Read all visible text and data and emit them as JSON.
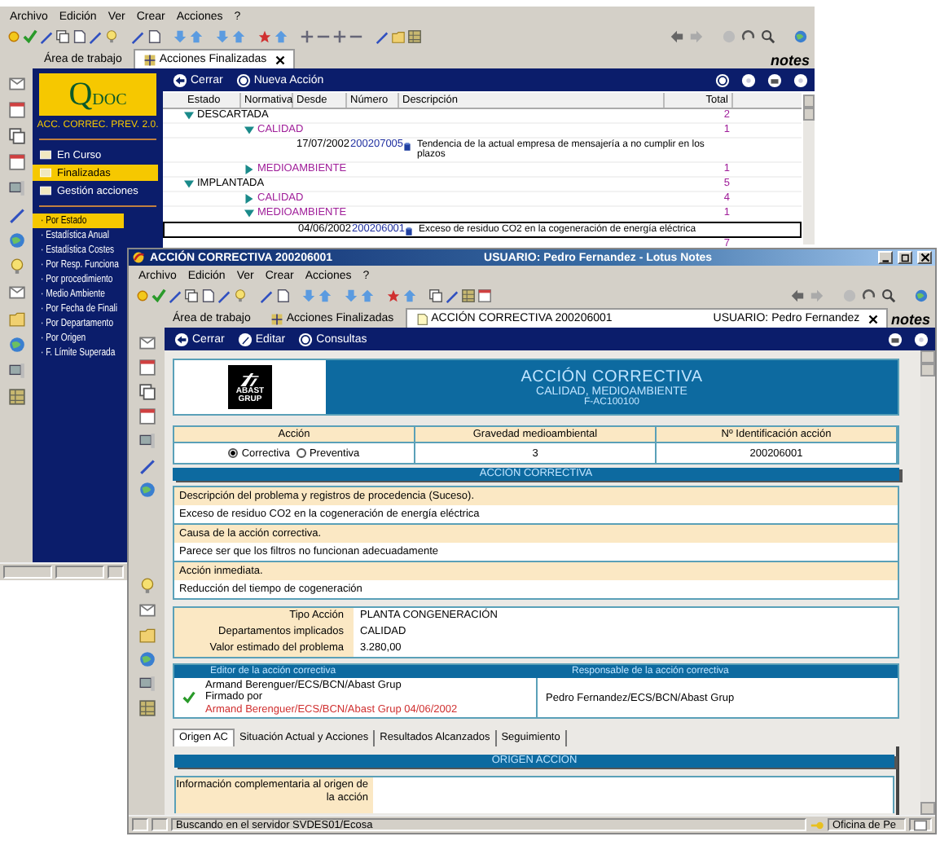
{
  "back_window": {
    "menu": [
      "Archivo",
      "Edición",
      "Ver",
      "Crear",
      "Acciones",
      "?"
    ],
    "tabs": [
      {
        "label": "Área de trabajo",
        "selected": false,
        "closable": false
      },
      {
        "label": "Acciones Finalizadas",
        "selected": true,
        "closable": true
      }
    ],
    "brand": "notes",
    "nav": {
      "logo_initial": "Q",
      "logo_rest": "DOC",
      "subtitle": "ACC. CORREC. PREV. 2.0.",
      "items": [
        {
          "label": "En Curso",
          "selected": false
        },
        {
          "label": "Finalizadas",
          "selected": true
        },
        {
          "label": "Gestión acciones",
          "selected": false
        }
      ],
      "views": [
        {
          "label": "· Por Estado",
          "selected": true
        },
        {
          "label": "· Estadística Anual",
          "selected": false
        },
        {
          "label": "· Estadística Costes",
          "selected": false
        },
        {
          "label": "· Por Resp. Funciona",
          "selected": false
        },
        {
          "label": "· Por procedimiento",
          "selected": false
        },
        {
          "label": "· Medio Ambiente",
          "selected": false
        },
        {
          "label": "· Por Fecha de Finali",
          "selected": false
        },
        {
          "label": "· Por Departamento",
          "selected": false
        },
        {
          "label": "· Por Origen",
          "selected": false
        },
        {
          "label": "· F. Límite Superada",
          "selected": false
        }
      ]
    },
    "actions": [
      "Cerrar",
      "Nueva Acción"
    ],
    "table": {
      "columns": [
        "Estado",
        "Normativa",
        "Desde",
        "Número",
        "Descripción",
        "Total"
      ],
      "rows": [
        {
          "label": "DESCARTADA",
          "expanded": true,
          "total": "2",
          "children": [
            {
              "label": "CALIDAD",
              "expanded": true,
              "total": "1",
              "children": [
                {
                  "date": "17/07/2002",
                  "number": "200207005",
                  "description": "Tendencia de la actual empresa de mensajería a no cumplir en los plazos",
                  "selected": false
                }
              ]
            },
            {
              "label": "MEDIOAMBIENTE",
              "expanded": false,
              "total": "1"
            }
          ]
        },
        {
          "label": "IMPLANTADA",
          "expanded": true,
          "total": "5",
          "children": [
            {
              "label": "CALIDAD",
              "expanded": false,
              "total": "4"
            },
            {
              "label": "MEDIOAMBIENTE",
              "expanded": true,
              "total": "1",
              "children": [
                {
                  "date": "04/06/2002",
                  "number": "200206001",
                  "description": "Exceso de residuo CO2 en la cogeneración de energía eléctrica",
                  "selected": true
                }
              ]
            }
          ]
        }
      ],
      "grand_total": "7"
    }
  },
  "front_window": {
    "title": "ACCIÓN CORRECTIVA 200206001",
    "title_user": "USUARIO: Pedro Fernandez - Lotus Notes",
    "menu": [
      "Archivo",
      "Edición",
      "Ver",
      "Crear",
      "Acciones",
      "?"
    ],
    "tabs": [
      {
        "label": "Área de trabajo",
        "selected": false,
        "closable": false
      },
      {
        "label": "Acciones Finalizadas",
        "selected": false,
        "closable": false
      },
      {
        "label": "ACCIÓN CORRECTIVA 200206001",
        "user": "USUARIO: Pedro Fernandez",
        "selected": true,
        "closable": true
      }
    ],
    "brand": "notes",
    "actions": [
      "Cerrar",
      "Editar",
      "Consultas"
    ],
    "form": {
      "header": {
        "logo_top": "ABAST",
        "logo_bottom": "GRUP",
        "title": "ACCIÓN CORRECTIVA",
        "subtitle": "CALIDAD, MEDIOAMBIENTE",
        "code": "F-AC100100"
      },
      "summary": {
        "columns": [
          "Acción",
          "Gravedad medioambiental",
          "Nº Identificación acción"
        ],
        "options": [
          {
            "label": "Correctiva",
            "selected": true
          },
          {
            "label": "Preventiva",
            "selected": false
          }
        ],
        "gravity": "3",
        "id": "200206001"
      },
      "section": "ACCIÓN CORRECTIVA",
      "fields": [
        {
          "label": "Descripción del problema y registros de procedencia (Suceso).",
          "value": "Exceso de residuo CO2 en la cogeneración de energía eléctrica"
        },
        {
          "label": "Causa de la acción correctiva.",
          "value": "Parece ser que los filtros no funcionan adecuadamente"
        },
        {
          "label": "Acción inmediata.",
          "value": "Reducción del tiempo de cogeneración"
        }
      ],
      "details": [
        {
          "label": "Tipo Acción",
          "value": "PLANTA CONGENERACIÓN"
        },
        {
          "label": "Departamentos implicados",
          "value": "CALIDAD"
        },
        {
          "label": "Valor estimado del problema",
          "value": "3.280,00"
        }
      ],
      "signatures": {
        "columns": [
          "Editor de la acción correctiva",
          "Responsable de la acción correctiva"
        ],
        "signed": true,
        "editor": "Armand Berenguer/ECS/BCN/Abast Grup",
        "signed_label": "Firmado por",
        "signed_by": "Armand Berenguer/ECS/BCN/Abast Grup 04/06/2002",
        "responsible": "Pedro Fernandez/ECS/BCN/Abast Grup"
      },
      "tabs": [
        {
          "label": "Origen AC",
          "selected": true
        },
        {
          "label": "Situación Actual y Acciones",
          "selected": false
        },
        {
          "label": "Resultados Alcanzados",
          "selected": false
        },
        {
          "label": "Seguimiento",
          "selected": false
        }
      ],
      "origin_section": "ORIGEN ACCIÓN",
      "origin_label": "Información complementaria al origen de la acción"
    },
    "status_bar": {
      "message": "Buscando en el servidor SVDES01/Ecosa",
      "location": "Oficina de Pe"
    }
  }
}
